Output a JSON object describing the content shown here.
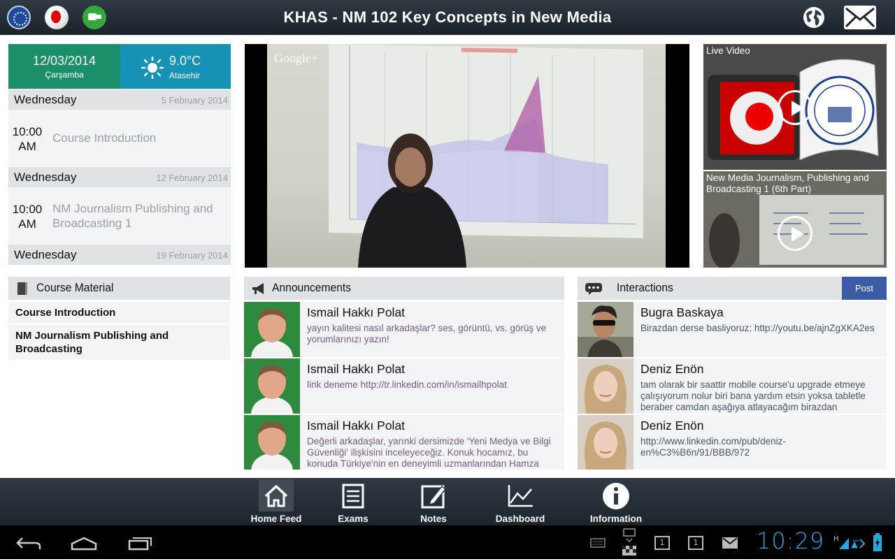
{
  "app": {
    "title": "KHAS - NM 102 Key Concepts in New Media"
  },
  "header_icons": [
    "university-logo-icon",
    "vodafone-icon",
    "hangouts-icon",
    "globe-icon",
    "mail-icon"
  ],
  "date_widget": {
    "date": "12/03/2014",
    "weekday": "Çarşamba"
  },
  "weather_widget": {
    "temperature": "9.0°C",
    "location": "Atasehir",
    "icon": "sun-icon"
  },
  "schedule": [
    {
      "day": "Wednesday",
      "date": "5 February 2014",
      "time": "10:00\nAM",
      "subject": "Course Introduction"
    },
    {
      "day": "Wednesday",
      "date": "12 February 2014",
      "time": "10:00\nAM",
      "subject": "NM Journalism Publishing and Broadcasting 1"
    },
    {
      "day": "Wednesday",
      "date": "19 February 2014"
    }
  ],
  "course_material": {
    "title": "Course Material",
    "items": [
      "Course Introduction",
      "NM Journalism Publishing and Broadcasting"
    ]
  },
  "main_video": {
    "overlay": "Google+"
  },
  "live_videos": [
    {
      "title": "Live Video"
    },
    {
      "title": "New Media Journalism, Publishing and Broadcasting 1 (6th Part)"
    }
  ],
  "announcements": {
    "title": "Announcements",
    "items": [
      {
        "author": "Ismail Hakkı Polat",
        "text": "yayın kalitesi nasıl arkadaşlar? ses, görüntü, vs. görüş ve yorumlarınızı yazın!"
      },
      {
        "author": "Ismail Hakkı Polat",
        "text": "link deneme http://tr.linkedin.com/in/ismailhpolat"
      },
      {
        "author": "Ismail Hakkı Polat",
        "text": "Değerli arkadaşlar, yarınki dersimizde 'Yeni Medya ve Bilgi Güvenliği' ilişkisini inceleyeceğiz. Konuk hocamız, bu konuda Türkiye'nin en deneyimli uzmanlarından Hamza"
      }
    ]
  },
  "interactions": {
    "title": "Interactions",
    "post_label": "Post",
    "items": [
      {
        "author": "Bugra Baskaya",
        "text": "Birazdan derse basliyoruz: http://youtu.be/ajnZgXKA2es"
      },
      {
        "author": "Deniz Enön",
        "text": "tam olarak bir saattir mobile course'u upgrade etmeye çalışıyorum nolur biri bana yardım etsin yoksa tabletle beraber camdan aşağıya atlayacağım birazdan"
      },
      {
        "author": "Deniz Enön",
        "text": "http://www.linkedin.com/pub/deniz-en%C3%B6n/91/BBB/972"
      }
    ]
  },
  "bottom_nav": [
    {
      "label": "Home Feed",
      "icon": "home-icon",
      "active": true
    },
    {
      "label": "Exams",
      "icon": "document-icon",
      "active": false
    },
    {
      "label": "Notes",
      "icon": "pencil-icon",
      "active": false
    },
    {
      "label": "Dashboard",
      "icon": "chart-icon",
      "active": false
    },
    {
      "label": "Information",
      "icon": "info-icon",
      "active": false
    }
  ],
  "system_bar": {
    "clock": "10:29",
    "notification_badge": "1"
  },
  "colors": {
    "date_bg": "#1b8f6a",
    "weather_bg": "#1693b4",
    "post_button": "#3b5ba6",
    "clock": "#2aa6e0"
  }
}
